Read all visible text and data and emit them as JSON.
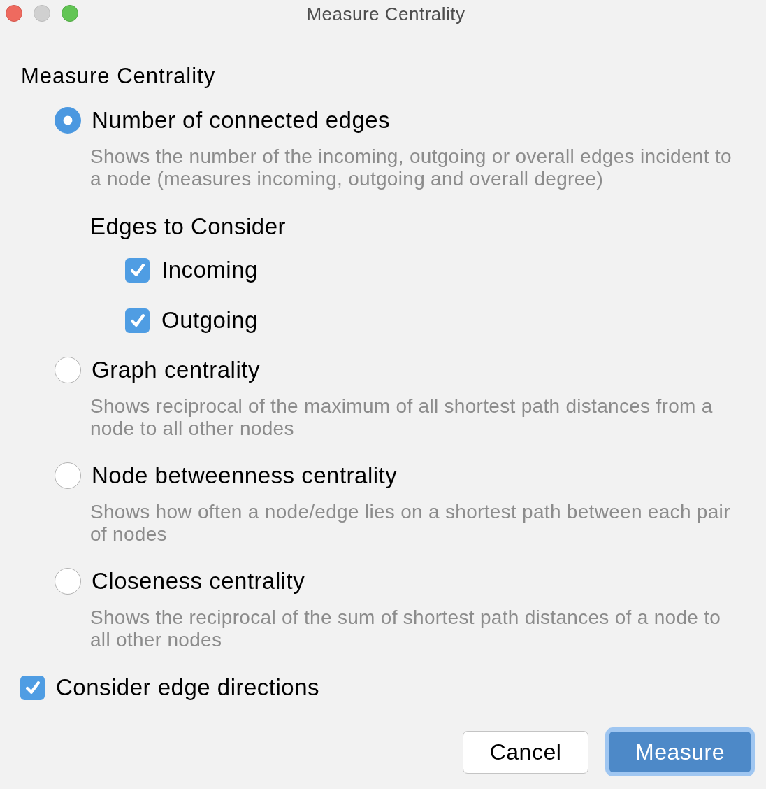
{
  "window": {
    "title": "Measure Centrality",
    "buttons": [
      {
        "kind": "close",
        "disabled": false
      },
      {
        "kind": "minimize",
        "disabled": true
      },
      {
        "kind": "zoom",
        "disabled": false
      }
    ]
  },
  "heading": "Measure Centrality",
  "options": [
    {
      "label": "Number of connected edges",
      "selected": true,
      "description": "Shows the number of the incoming, outgoing or overall edges incident to a node (measures incoming, outgoing and overall degree)",
      "group": {
        "title": "Edges to Consider",
        "checkboxes": [
          {
            "label": "Incoming",
            "checked": true
          },
          {
            "label": "Outgoing",
            "checked": true
          }
        ]
      }
    },
    {
      "label": "Graph centrality",
      "selected": false,
      "description": "Shows reciprocal of the maximum of all shortest path distances from a node to all other nodes"
    },
    {
      "label": "Node betweenness centrality",
      "selected": false,
      "description": "Shows how often a node/edge lies on a shortest path between each pair of nodes"
    },
    {
      "label": "Closeness centrality",
      "selected": false,
      "description": "Shows the reciprocal of the sum of shortest path distances of a node to all other nodes"
    }
  ],
  "consider_edge_directions": {
    "label": "Consider edge directions",
    "checked": true
  },
  "buttons": [
    {
      "label": "Cancel",
      "kind": "cancel"
    },
    {
      "label": "Measure",
      "kind": "submit"
    }
  ]
}
